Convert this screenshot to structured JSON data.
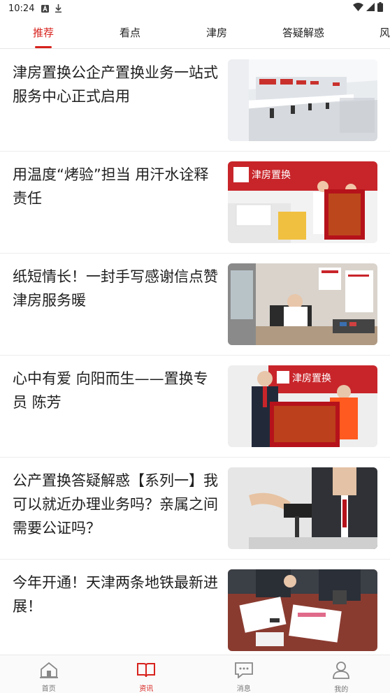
{
  "status_bar": {
    "time": "10:24"
  },
  "tabs": [
    {
      "label": "推荐",
      "active": true
    },
    {
      "label": "看点",
      "active": false
    },
    {
      "label": "津房",
      "active": false
    },
    {
      "label": "答疑解惑",
      "active": false
    },
    {
      "label": "风",
      "active": false
    }
  ],
  "news": [
    {
      "title": "津房置换公企产置换业务一站式服务中心正式启用",
      "image": "service-hall-photo"
    },
    {
      "title": "用温度“烤验”担当 用汗水诠释责任",
      "image": "banner-award-photo",
      "image_text": {
        "brand": "津房置换"
      }
    },
    {
      "title": "纸短情长！一封手写感谢信点赞津房服务暖",
      "image": "service-desk-photo"
    },
    {
      "title": "心中有爱 向阳而生——置换专员 陈芳",
      "image": "banner-award-photo-2",
      "image_text": {
        "brand": "津房置换"
      }
    },
    {
      "title": "公产置换答疑解惑【系列一】我可以就近办理业务吗？亲属之间需要公证吗？",
      "image": "handshake-photo"
    },
    {
      "title": "今年开通！天津两条地铁最新进展！",
      "image": "documents-photo"
    }
  ],
  "bottom_nav": [
    {
      "label": "首页",
      "icon": "home-icon",
      "active": false
    },
    {
      "label": "资讯",
      "icon": "book-icon",
      "active": true
    },
    {
      "label": "消息",
      "icon": "message-icon",
      "active": false
    },
    {
      "label": "我的",
      "icon": "user-icon",
      "active": false
    }
  ],
  "colors": {
    "accent": "#d7221d",
    "divider": "#ececec"
  }
}
